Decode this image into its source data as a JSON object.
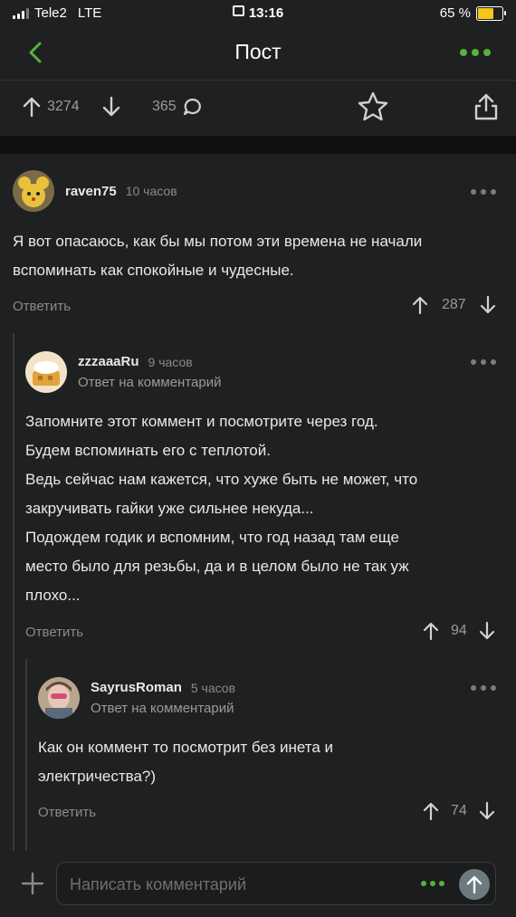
{
  "status": {
    "carrier": "Tele2",
    "network": "LTE",
    "time": "13:16",
    "battery": "65 %",
    "battery_level": 0.65
  },
  "header": {
    "title": "Пост"
  },
  "actions": {
    "upvotes": "3274",
    "comments": "365"
  },
  "comments": [
    {
      "user": "raven75",
      "time": "10 часов",
      "lines": [
        "Я вот опасаюсь, как бы мы потом эти времена не начали",
        "вспоминать как спокойные и чудесные."
      ],
      "reply_label": "Ответить",
      "rating": "287"
    },
    {
      "user": "zzzaaaRu",
      "time": "9 часов",
      "reply_to": "Ответ на комментарий",
      "lines": [
        "Запомните этот коммент и посмотрите через год.",
        "Будем вспоминать его с теплотой.",
        "Ведь сейчас нам кажется, что хуже быть не может, что",
        "закручивать гайки уже сильнее некуда...",
        "Подождем годик и вспомним, что год назад там еще",
        "место было для резьбы, да и в целом было не так уж",
        "плохо..."
      ],
      "reply_label": "Ответить",
      "rating": "94"
    },
    {
      "user": "SayrusRoman",
      "time": "5 часов",
      "reply_to": "Ответ на комментарий",
      "lines": [
        "Как он коммент то посмотрит без инета и",
        "электричества?)"
      ],
      "reply_label": "Ответить",
      "rating": "74"
    }
  ],
  "composer": {
    "placeholder": "Написать комментарий"
  },
  "colors": {
    "accent": "#55b33b",
    "background": "#1f2021"
  }
}
